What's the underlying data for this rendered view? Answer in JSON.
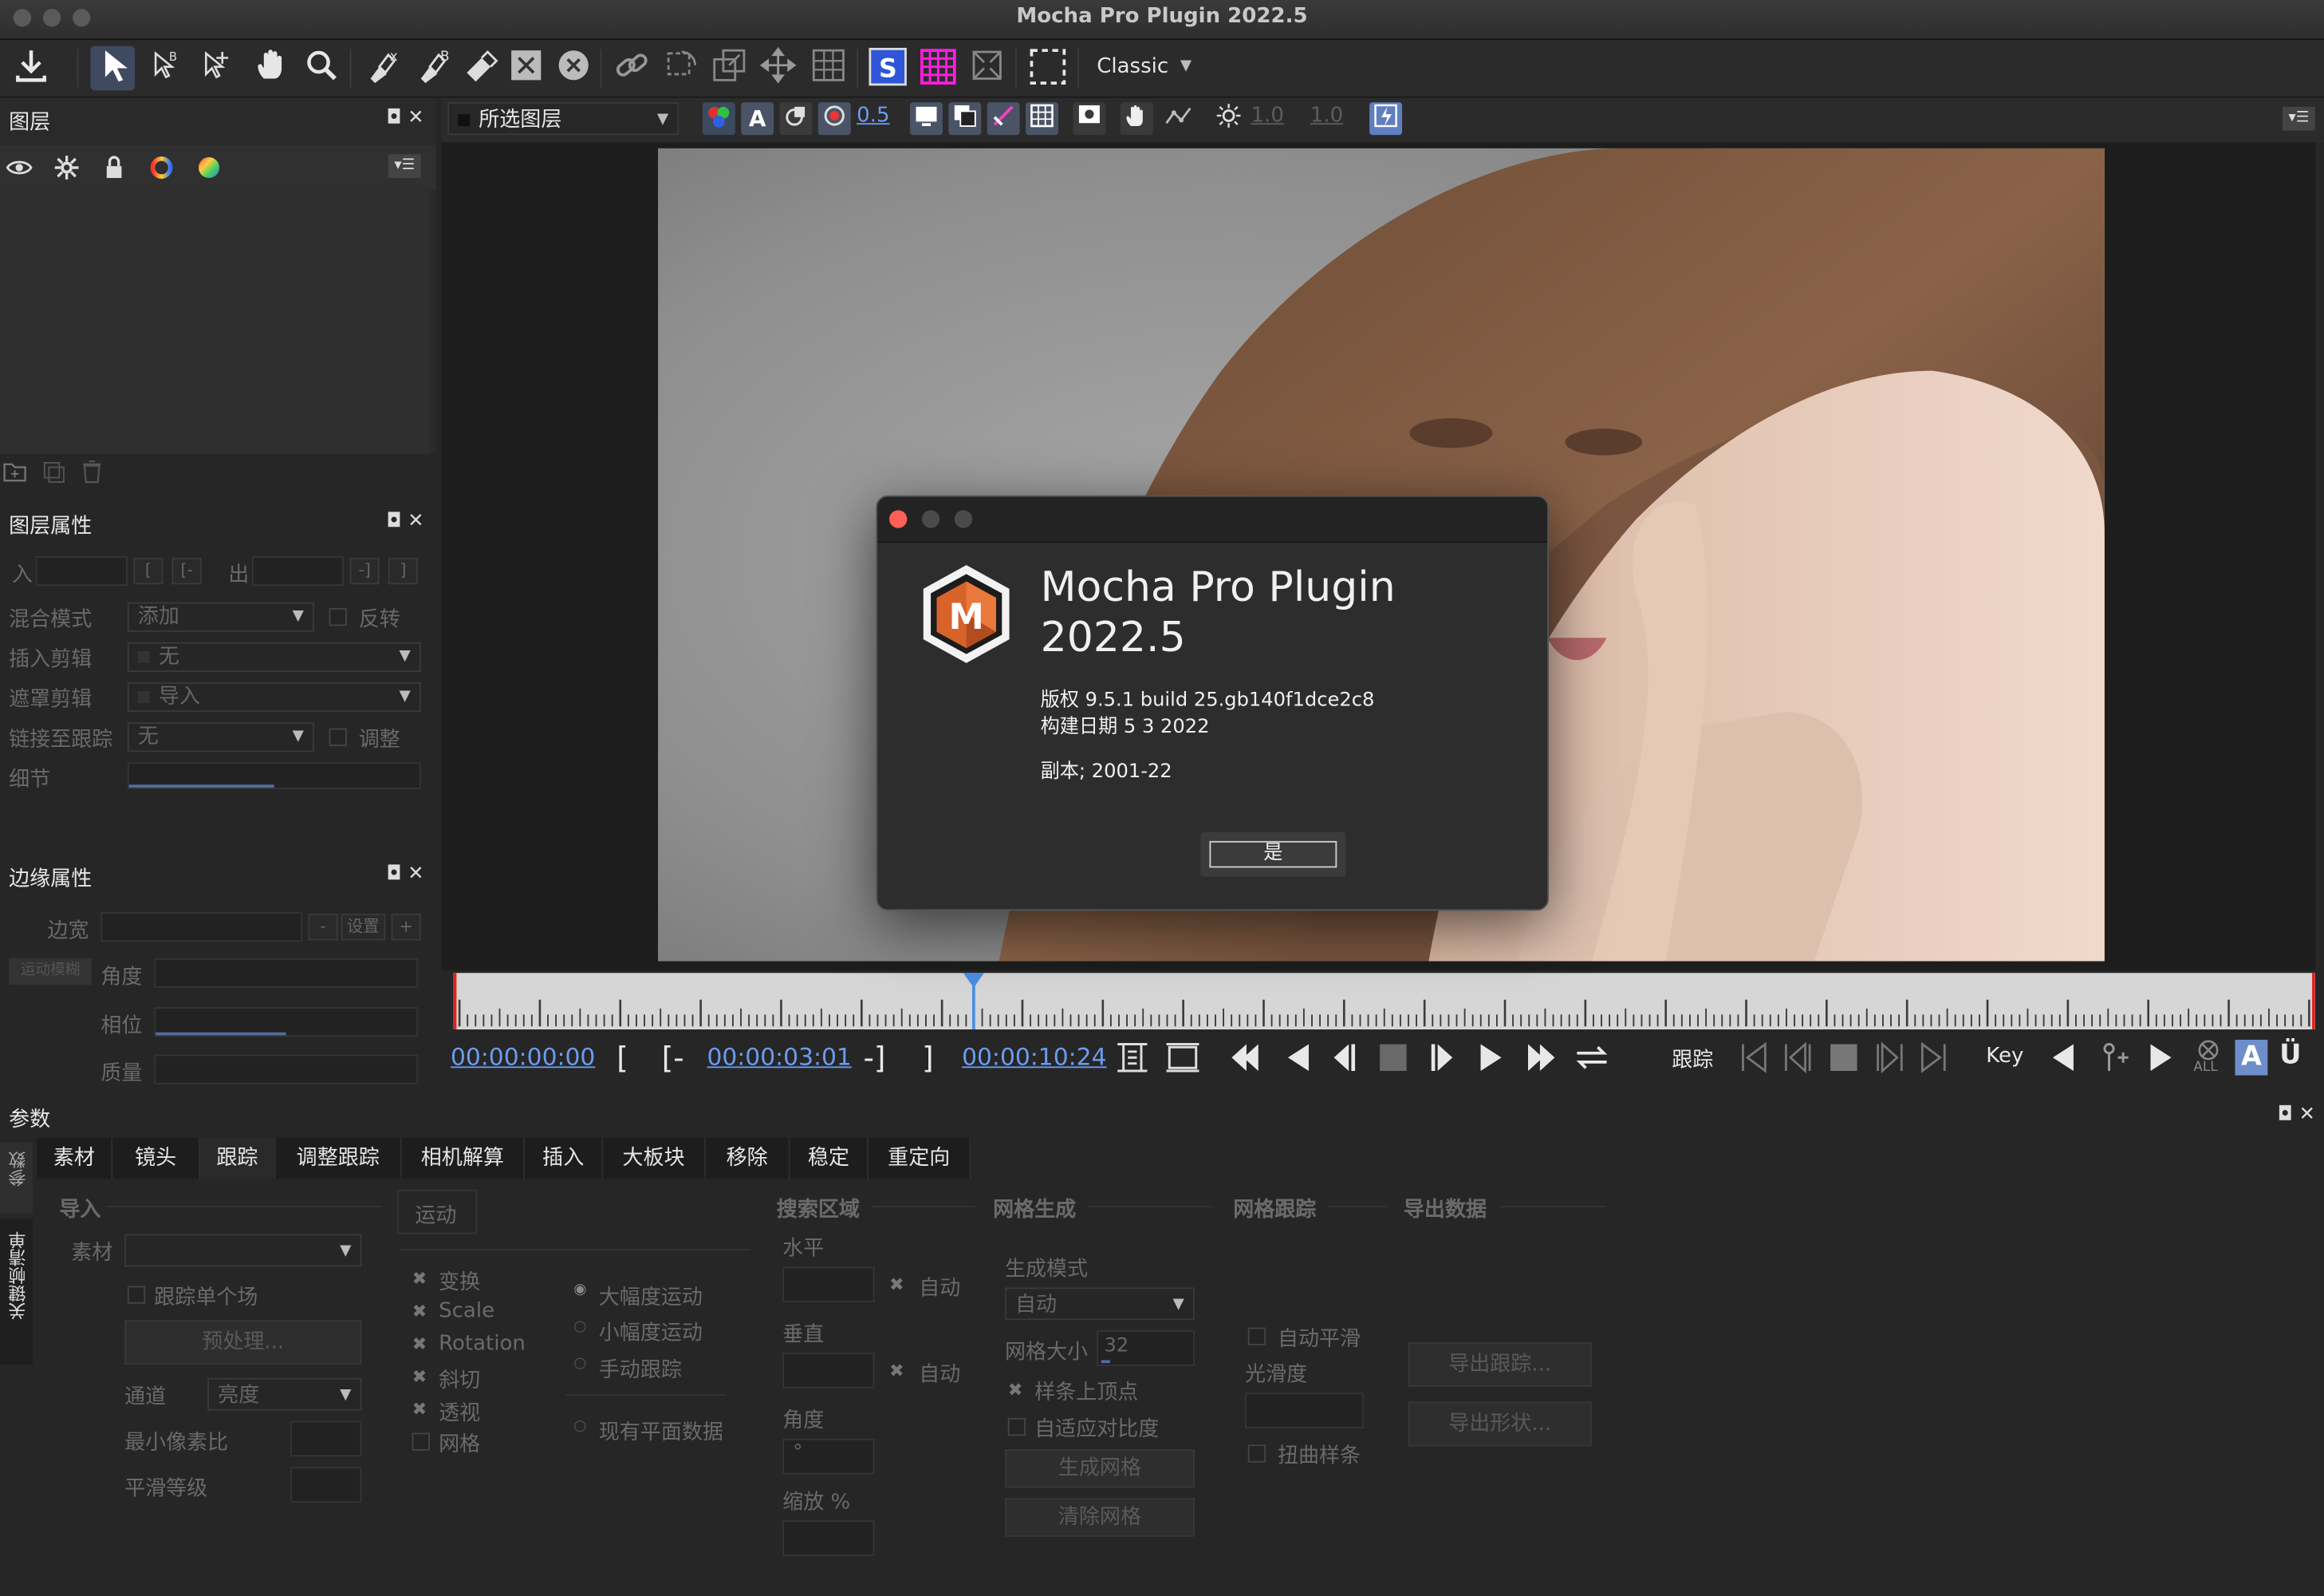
{
  "window": {
    "title": "Mocha Pro Plugin 2022.5"
  },
  "toolbar": {
    "workspace_select": "Classic",
    "icons": [
      "export-icon",
      "select-arrow-icon",
      "add-point-icon",
      "add-point-plus-icon",
      "hand-icon",
      "zoom-icon",
      "x-spline-pen-icon",
      "bezier-pen-icon",
      "eraser-icon",
      "x-box-icon",
      "x-circle-icon",
      "link-icon",
      "rotate-icon",
      "scale-icon",
      "move-icon",
      "grid-icon",
      "s-surface-icon",
      "grid-magenta-icon",
      "align-icon",
      "dotted-rect-icon"
    ]
  },
  "viewer_toolbar": {
    "layer_select": "所选图层",
    "opacity": "0.5",
    "exposure": "1.0",
    "gamma": "1.0"
  },
  "layers_panel": {
    "title": "图层",
    "icons": [
      "eye-icon",
      "gear-icon",
      "lock-icon",
      "color-ring-icon",
      "color-wheel-icon"
    ]
  },
  "layer_props": {
    "title": "图层属性",
    "in_label": "入",
    "out_label": "出",
    "blend_mode_label": "混合模式",
    "blend_mode_value": "添加",
    "invert_label": "反转",
    "insert_clip_label": "插入剪辑",
    "insert_clip_value": "无",
    "matte_clip_label": "遮罩剪辑",
    "matte_clip_value": "导入",
    "link_track_label": "链接至跟踪",
    "link_track_value": "无",
    "adjust_label": "调整",
    "detail_label": "细节"
  },
  "edge_props": {
    "title": "边缘属性",
    "width_label": "边宽",
    "set_label": "设置",
    "motion_blur_label": "运动模糊",
    "angle_label": "角度",
    "phase_label": "相位",
    "quality_label": "质量"
  },
  "timeline": {
    "tc_start": "00:00:00:00",
    "tc_current": "00:00:03:01",
    "tc_end": "00:00:10:24",
    "in_bracket": "[",
    "in_set": "[-",
    "out_set": "-]",
    "out_bracket": "]",
    "track_label": "跟踪",
    "key_label": "Key",
    "all_label": "ALL",
    "auto_key": "A",
    "u_label": "Ü",
    "playhead_fraction": 0.278
  },
  "params": {
    "title": "参数",
    "side_tabs": [
      "参数",
      "关键帧清单"
    ],
    "tabs": [
      "素材",
      "镜头",
      "跟踪",
      "调整跟踪",
      "相机解算",
      "插入",
      "大板块",
      "移除",
      "稳定",
      "重定向"
    ],
    "active_tab": "跟踪",
    "import": {
      "title": "导入",
      "clip_label": "素材",
      "single_field_label": "跟踪单个场",
      "preprocess_button": "预处理...",
      "channel_label": "通道",
      "channel_value": "亮度",
      "min_pixels_label": "最小像素比",
      "smoothing_label": "平滑等级"
    },
    "motion": {
      "title": "运动",
      "checks": [
        "变换",
        "Scale",
        "Rotation",
        "斜切",
        "透视",
        "网格"
      ],
      "radios": [
        "大幅度运动",
        "小幅度运动",
        "手动跟踪"
      ],
      "existing_planar": "现有平面数据"
    },
    "search_area": {
      "title": "搜索区域",
      "horizontal_label": "水平",
      "vertical_label": "垂直",
      "auto_label": "自动",
      "angle_label": "角度",
      "angle_unit": "°",
      "zoom_label": "缩放 %"
    },
    "mesh_gen": {
      "title": "网格生成",
      "mode_label": "生成模式",
      "mode_value": "自动",
      "size_label": "网格大小",
      "size_value": "32",
      "spline_vertices": "样条上顶点",
      "adaptive_contrast": "自适应对比度",
      "generate_button": "生成网格",
      "clear_button": "清除网格"
    },
    "mesh_track": {
      "title": "网格跟踪",
      "auto_smooth": "自动平滑",
      "smoothness_label": "光滑度",
      "warp_spline": "扭曲样条"
    },
    "export": {
      "title": "导出数据",
      "export_tracking_button": "导出跟踪...",
      "export_shape_button": "导出形状..."
    }
  },
  "about_dialog": {
    "title_line1": "Mocha Pro Plugin",
    "title_line2": "2022.5",
    "version": "版权 9.5.1 build 25.gb140f1dce2c8",
    "build_date": "构建日期 5 3 2022",
    "copyright": "副本; 2001-22",
    "ok_button": "是",
    "logo_letter": "M"
  },
  "colors": {
    "accent": "#6b9cf0",
    "logo_orange": "#d8632a",
    "close_red": "#fe5f57"
  }
}
